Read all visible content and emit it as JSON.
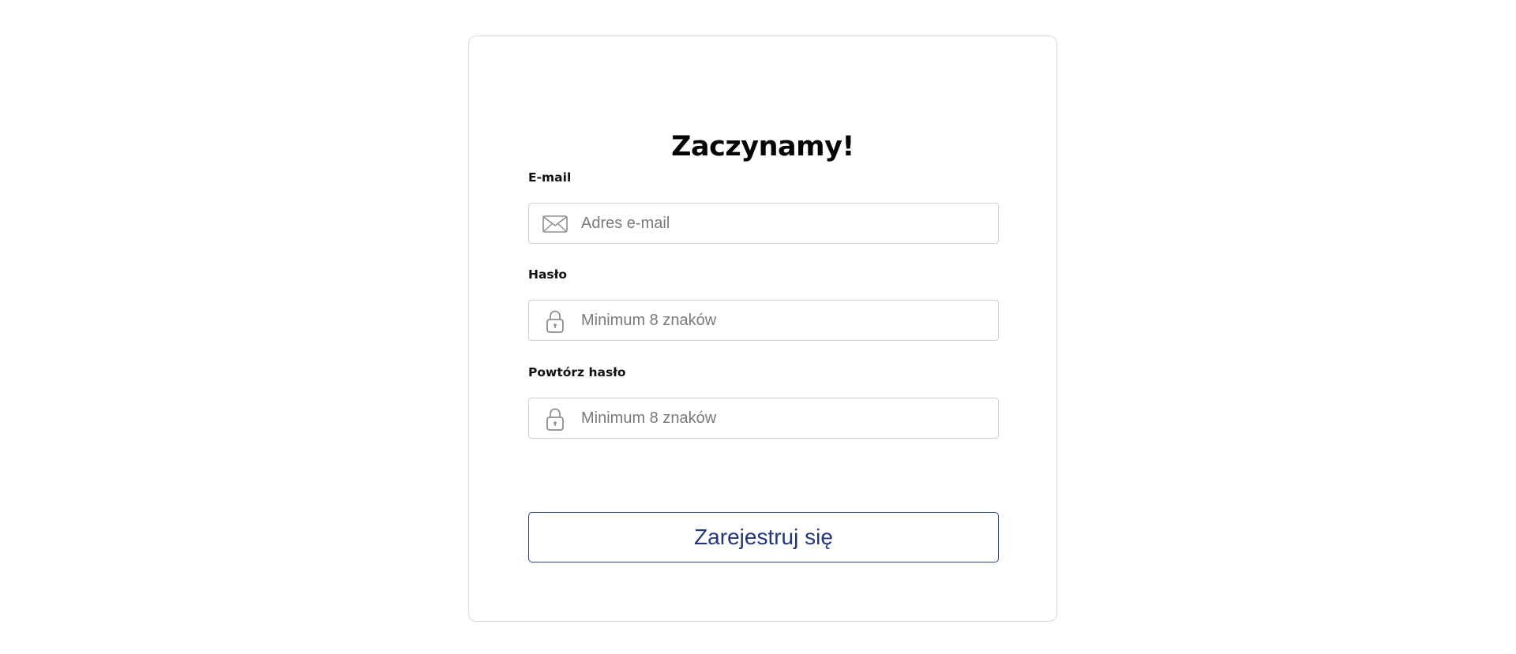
{
  "form": {
    "title": "Zaczynamy!",
    "fields": [
      {
        "label": "E-mail",
        "placeholder": "Adres e-mail",
        "value": "",
        "icon": "envelope-icon"
      },
      {
        "label": "Hasło",
        "placeholder": "Minimum 8 znaków",
        "value": "",
        "icon": "lock-icon"
      },
      {
        "label": "Powtórz hasło",
        "placeholder": "Minimum 8 znaków",
        "value": "",
        "icon": "lock-icon"
      }
    ],
    "submit_label": "Zarejestruj się"
  },
  "colors": {
    "button_accent": "#2d3f8f",
    "input_border": "#cdd0d6",
    "card_border": "#d6d8dd",
    "icon_gray": "#8e8e8e"
  }
}
